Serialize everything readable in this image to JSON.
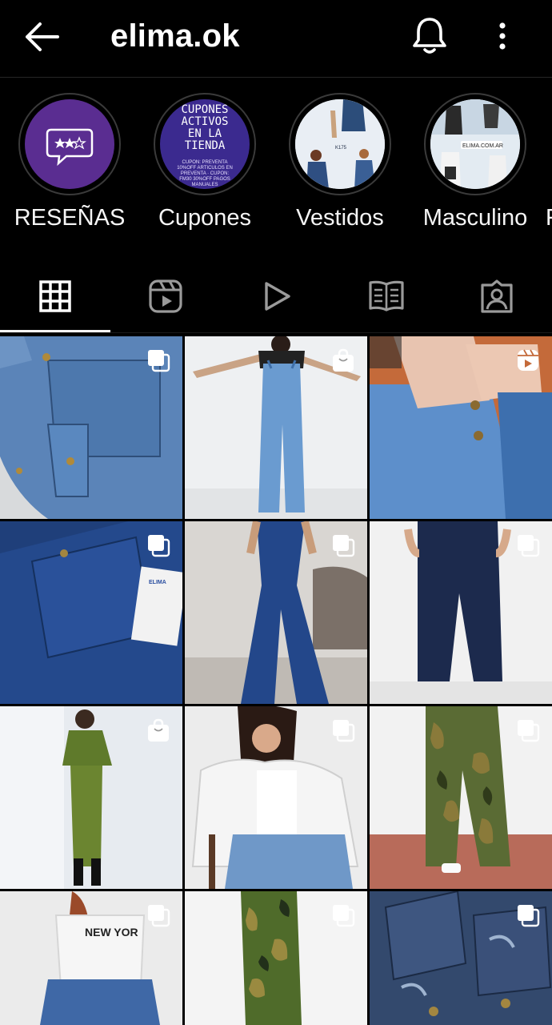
{
  "header": {
    "username": "elima.ok",
    "back_icon": "arrow-left-icon",
    "bell_icon": "bell-icon",
    "more_icon": "more-vertical-icon"
  },
  "highlights": [
    {
      "label": "RESEÑAS"
    },
    {
      "label": "Cupones",
      "cover_text": "CUPONES ACTIVOS EN LA TIENDA",
      "small_text": "CUPON: PREVENTA 10%OFF ARTICULOS EN PREVENTA · CUPON: FM30 30%OFF PAGOS MANUALES"
    },
    {
      "label": "Vestidos",
      "cover_text": "K175"
    },
    {
      "label": "Masculino",
      "cover_text": "ELIMA.COM.AR"
    }
  ],
  "tabs": [
    {
      "name": "tab-posts",
      "icon": "grid-icon",
      "active": true
    },
    {
      "name": "tab-reels",
      "icon": "reels-icon"
    },
    {
      "name": "tab-videos",
      "icon": "play-icon"
    },
    {
      "name": "tab-guides",
      "icon": "guide-icon"
    },
    {
      "name": "tab-tagged",
      "icon": "tagged-person-icon"
    }
  ],
  "posts": [
    {
      "badge": "carousel",
      "desc": "denim overall pocket"
    },
    {
      "badge": "shop",
      "desc": "denim overalls model"
    },
    {
      "badge": "reel",
      "desc": "denim button close-up"
    },
    {
      "badge": "carousel",
      "desc": "dark denim with tag",
      "tag_text": "ELIMA"
    },
    {
      "badge": "carousel",
      "desc": "flare jeans"
    },
    {
      "badge": "carousel",
      "desc": "dark flare jeans"
    },
    {
      "badge": "shop",
      "desc": "green denim set"
    },
    {
      "badge": "carousel",
      "desc": "white denim jacket"
    },
    {
      "badge": "carousel",
      "desc": "camo pants"
    },
    {
      "badge": "carousel",
      "desc": "white hoodie jeans",
      "tag_text": "NEW YOR"
    },
    {
      "badge": "carousel",
      "desc": "camo skirt"
    },
    {
      "badge": "carousel",
      "desc": "distressed denim jacket"
    }
  ],
  "colors": {
    "background": "#000000",
    "text": "#ffffff",
    "highlight_purple": "#5a2d91",
    "denim": "#3f6fa8"
  }
}
